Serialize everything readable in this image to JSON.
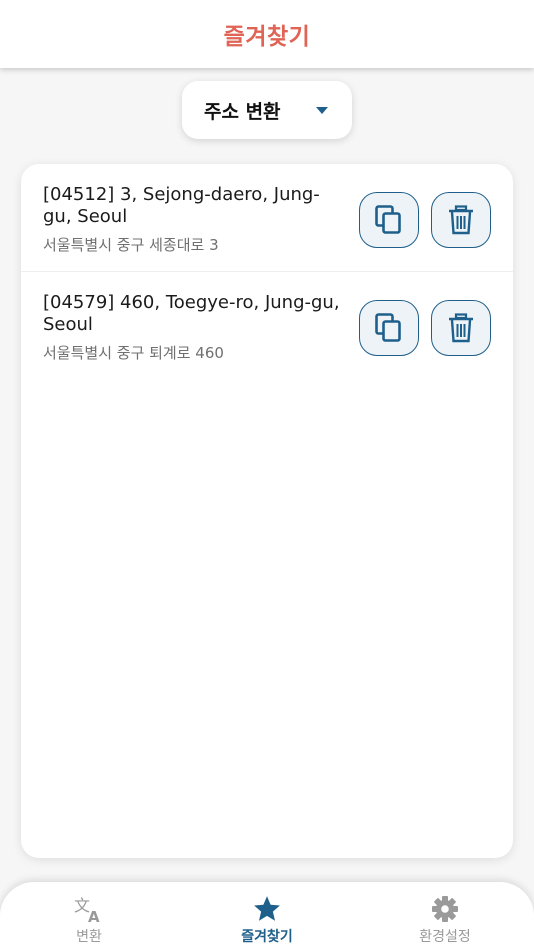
{
  "header": {
    "title": "즐겨찾기"
  },
  "dropdown": {
    "selected": "주소 변환"
  },
  "favorites": [
    {
      "english": "[04512] 3, Sejong-daero, Jung-gu, Seoul",
      "korean": "서울특별시 중구 세종대로 3"
    },
    {
      "english": "[04579] 460, Toegye-ro, Jung-gu, Seoul",
      "korean": "서울특별시 중구 퇴계로 460"
    }
  ],
  "nav": {
    "convert": "변환",
    "favorites": "즐겨찾기",
    "settings": "환경설정",
    "active": "favorites"
  },
  "colors": {
    "accent": "#1f5f8b",
    "title": "#e06456",
    "inactive": "#9a9a9a"
  },
  "icons": {
    "copy": "copy-icon",
    "delete": "trash-icon",
    "convert": "translate-icon",
    "favorites": "star-icon",
    "settings": "gear-icon",
    "dropdown": "caret-down-icon"
  }
}
